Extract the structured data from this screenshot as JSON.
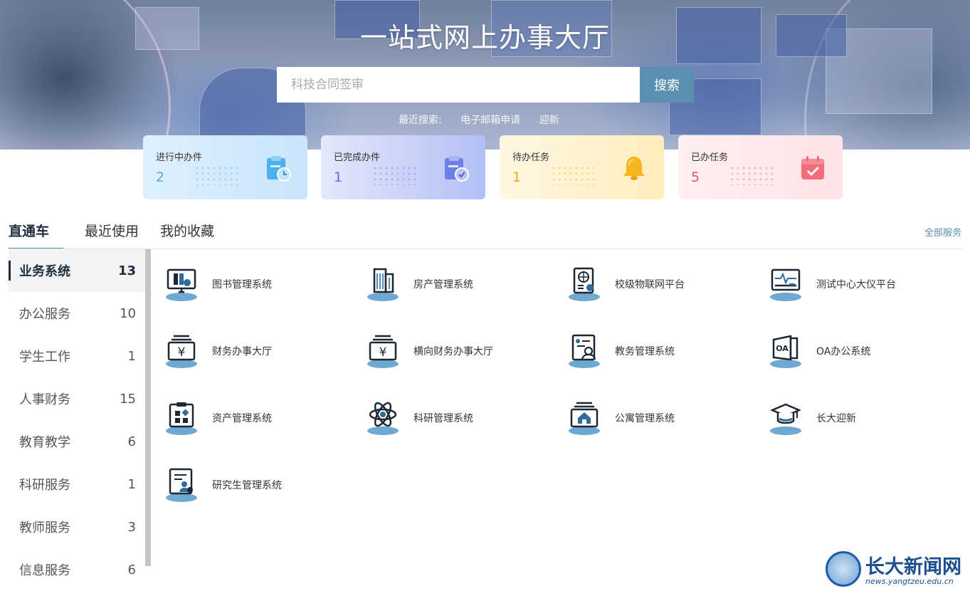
{
  "hero": {
    "title": "一站式网上办事大厅",
    "search_placeholder": "科技合同签审",
    "search_button": "搜索",
    "recent_label": "最近搜索:",
    "recent_items": [
      "电子邮箱申请",
      "迎新"
    ]
  },
  "stats": [
    {
      "label": "进行中办件",
      "value": "2",
      "icon": "clipboard-clock-icon",
      "color": "#4aa3e0"
    },
    {
      "label": "已完成办件",
      "value": "1",
      "icon": "clipboard-check-icon",
      "color": "#5a6fd8"
    },
    {
      "label": "待办任务",
      "value": "1",
      "icon": "bell-icon",
      "color": "#f4b21a"
    },
    {
      "label": "已办任务",
      "value": "5",
      "icon": "calendar-check-icon",
      "color": "#ef5b67"
    }
  ],
  "tabs": [
    "直通车",
    "最近使用",
    "我的收藏"
  ],
  "active_tab": "直通车",
  "all_services": "全部服务",
  "categories": [
    {
      "label": "业务系统",
      "count": "13"
    },
    {
      "label": "办公服务",
      "count": "10"
    },
    {
      "label": "学生工作",
      "count": "1"
    },
    {
      "label": "人事财务",
      "count": "15"
    },
    {
      "label": "教育教学",
      "count": "6"
    },
    {
      "label": "科研服务",
      "count": "1"
    },
    {
      "label": "教师服务",
      "count": "3"
    },
    {
      "label": "信息服务",
      "count": "6"
    }
  ],
  "services": [
    {
      "label": "图书管理系统",
      "icon": "library-monitor-icon"
    },
    {
      "label": "房产管理系统",
      "icon": "building-icon"
    },
    {
      "label": "校级物联网平台",
      "icon": "iot-globe-icon"
    },
    {
      "label": "测试中心大仪平台",
      "icon": "instrument-monitor-icon"
    },
    {
      "label": "财务办事大厅",
      "icon": "yuan-finance-icon"
    },
    {
      "label": "横向财务办事大厅",
      "icon": "yuan-finance-icon"
    },
    {
      "label": "教务管理系统",
      "icon": "teaching-user-icon"
    },
    {
      "label": "OA办公系统",
      "icon": "oa-icon"
    },
    {
      "label": "资产管理系统",
      "icon": "asset-clipboard-icon"
    },
    {
      "label": "科研管理系统",
      "icon": "atom-icon"
    },
    {
      "label": "公寓管理系统",
      "icon": "apartment-house-icon"
    },
    {
      "label": "长大迎新",
      "icon": "graduation-cap-icon"
    },
    {
      "label": "研究生管理系统",
      "icon": "graduate-doc-icon"
    }
  ],
  "watermark": {
    "title": "长大新闻网",
    "url": "news.yangtzeu.edu.cn"
  }
}
